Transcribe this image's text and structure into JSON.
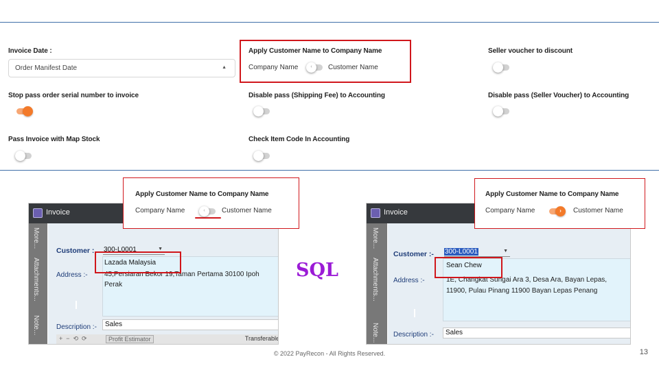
{
  "settings": {
    "invoice_date": {
      "label": "Invoice Date :",
      "value": "Order Manifest Date"
    },
    "apply_customer_name": {
      "label": "Apply Customer Name to Company Name",
      "left": "Company Name",
      "right": "Customer Name",
      "enabled": false
    },
    "seller_voucher_discount": {
      "label": "Seller voucher to discount",
      "enabled": false
    },
    "stop_pass_serial": {
      "label": "Stop pass order serial number to invoice",
      "enabled": true
    },
    "disable_shipping_fee": {
      "label": "Disable pass (Shipping Fee) to Accounting",
      "enabled": false
    },
    "disable_seller_voucher": {
      "label": "Disable pass (Seller Voucher) to Accounting",
      "enabled": false
    },
    "pass_invoice_map_stock": {
      "label": "Pass Invoice with Map Stock",
      "enabled": false
    },
    "check_item_code": {
      "label": "Check Item Code In Accounting",
      "enabled": false
    }
  },
  "left_example": {
    "popup": {
      "title": "Apply Customer Name to Company Name",
      "left": "Company Name",
      "right": "Customer Name",
      "enabled": false
    },
    "window": {
      "title": "Invoice",
      "tabs": [
        "More...",
        "Attachments...",
        "Note..."
      ],
      "customer_label": "Customer :",
      "customer_code": "300-L0001",
      "company_name": "Lazada Malaysia",
      "address_label": "Address :-",
      "address_line1": "45,Persiaran Bekor 19,Taman Pertama 30100 Ipoh",
      "address_line2": "Perak",
      "description_label": "Description :-",
      "description_value": "Sales",
      "profit_estimator": "Profit Estimator",
      "transferable": "Transferable"
    }
  },
  "middle_label": "SQL",
  "right_example": {
    "popup": {
      "title": "Apply Customer Name to Company Name",
      "left": "Company Name",
      "right": "Customer Name",
      "enabled": true
    },
    "window": {
      "title": "Invoice",
      "tabs": [
        "More...",
        "Attachments...",
        "Note..."
      ],
      "customer_label": "Customer :-",
      "customer_code": "300-L0001",
      "company_name": "Sean Chew",
      "address_label": "Address :-",
      "address_line1": "1E, Changkat Sungai Ara 3, Desa Ara, Bayan Lepas,",
      "address_line2": "11900, Pulau Pinang 11900 Bayan Lepas Penang",
      "description_label": "Description :-",
      "description_value": "Sales"
    }
  },
  "footer": {
    "copyright": "© 2022 PayRecon - All Rights Reserved.",
    "page_number": "13"
  },
  "colors": {
    "accent_orange": "#f37a2a",
    "highlight_red": "#d0161b",
    "sql_purple": "#9b1bd6",
    "rule_blue": "#3f6fa8"
  }
}
